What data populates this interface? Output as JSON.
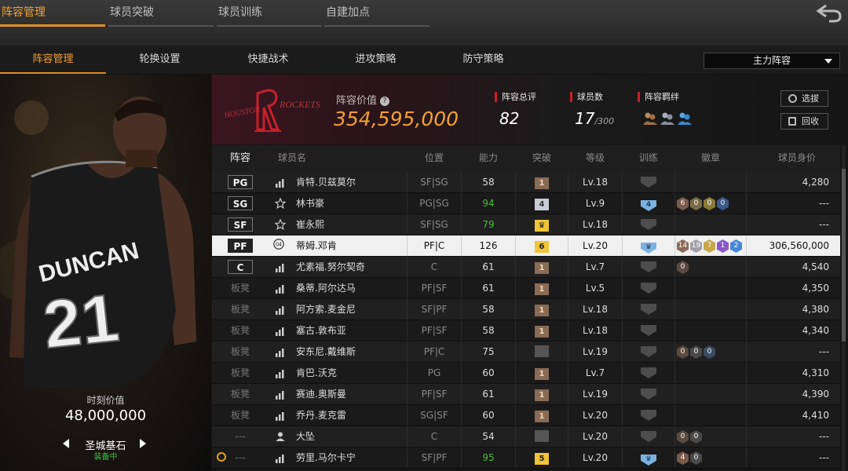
{
  "top_tabs": [
    {
      "label": "阵容管理",
      "active": true
    },
    {
      "label": "球员突破",
      "active": false
    },
    {
      "label": "球员训练",
      "active": false
    },
    {
      "label": "自建加点",
      "active": false
    }
  ],
  "sub_tabs": [
    {
      "label": "阵容管理",
      "active": true
    },
    {
      "label": "轮换设置",
      "active": false
    },
    {
      "label": "快捷战术",
      "active": false
    },
    {
      "label": "进攻策略",
      "active": false
    },
    {
      "label": "防守策略",
      "active": false
    }
  ],
  "lineup_select": {
    "value": "主力阵容"
  },
  "player_card": {
    "jersey_name": "DUNCAN",
    "jersey_number": "21",
    "moment_label": "时刻价值",
    "moment_value": "48,000,000",
    "card_name": "圣城基石",
    "equipped": "装备中"
  },
  "team": {
    "logo_text_left": "HOUSTON",
    "logo_text_right": "ROCKETS",
    "value_label": "阵容价值",
    "value": "354,595,000",
    "rating_label": "阵容总评",
    "rating": "82",
    "count_label": "球员数",
    "count": "17",
    "count_max": "/300",
    "bond_label": "阵容羁绊",
    "select_btn": "选拔",
    "recycle_btn": "回收"
  },
  "colors": {
    "accent": "#f2a033",
    "green": "#4dba3b",
    "rocket_red": "#c8202a"
  },
  "table": {
    "headers": {
      "lineup": "阵容",
      "name": "球员名",
      "position": "位置",
      "ability": "能力",
      "breakthrough": "突破",
      "level": "等级",
      "training": "训练",
      "badge": "徽章",
      "worth": "球员身价"
    },
    "rows": [
      {
        "slot": "PG",
        "badge_slot": true,
        "type": "bars",
        "name": "肯特.贝兹莫尔",
        "pos": "SF|SG",
        "ability": "58",
        "green": false,
        "brk": "1",
        "brk_color": "brown",
        "level": "Lv.18",
        "train": "",
        "badges": [],
        "worth": "4,280"
      },
      {
        "slot": "SG",
        "badge_slot": true,
        "type": "star",
        "name": "林书豪",
        "pos": "PG|SG",
        "ability": "94",
        "green": true,
        "brk": "4",
        "brk_color": "silver",
        "level": "Lv.9",
        "train": "4",
        "badges": [
          {
            "t": "6",
            "c": "#7a5a48"
          },
          {
            "t": "0",
            "c": "#7a6a48"
          },
          {
            "t": "0",
            "c": "#8a7a3a"
          },
          {
            "t": "0",
            "c": "#3a5a8a"
          }
        ],
        "worth": "---"
      },
      {
        "slot": "SF",
        "badge_slot": true,
        "type": "star",
        "name": "崔永熙",
        "pos": "SF|SG",
        "ability": "79",
        "green": true,
        "brk": "♛",
        "brk_color": "gold",
        "level": "Lv.18",
        "train": "",
        "badges": [],
        "worth": "---"
      },
      {
        "slot": "PF",
        "badge_slot": true,
        "type": "num",
        "type_text": "04",
        "name": "蒂姆.邓肯",
        "pos": "PF|C",
        "ability": "126",
        "green": false,
        "brk": "6",
        "brk_color": "gold",
        "level": "Lv.20",
        "train": "♛",
        "badges": [
          {
            "t": "14",
            "c": "#8a6a58"
          },
          {
            "t": "19",
            "c": "#a0a0a8"
          },
          {
            "t": "7",
            "c": "#c8a848"
          },
          {
            "t": "1",
            "c": "#8a58c8"
          },
          {
            "t": "2",
            "c": "#4888d8"
          }
        ],
        "worth": "306,560,000",
        "selected": true
      },
      {
        "slot": "C",
        "badge_slot": true,
        "type": "bars",
        "name": "尤素福.努尔契奇",
        "pos": "C",
        "ability": "61",
        "green": false,
        "brk": "1",
        "brk_color": "brown",
        "level": "Lv.7",
        "train": "",
        "badges": [
          {
            "t": "0",
            "c": "#5a4a40"
          }
        ],
        "worth": "4,540"
      },
      {
        "slot": "板凳",
        "badge_slot": false,
        "type": "bars",
        "name": "桑蒂.阿尔达马",
        "pos": "PF|SF",
        "ability": "61",
        "green": false,
        "brk": "1",
        "brk_color": "brown",
        "level": "Lv.5",
        "train": "",
        "badges": [],
        "worth": "4,350"
      },
      {
        "slot": "板凳",
        "badge_slot": false,
        "type": "bars",
        "name": "阿方索.麦金尼",
        "pos": "SF|PF",
        "ability": "58",
        "green": false,
        "brk": "1",
        "brk_color": "brown",
        "level": "Lv.18",
        "train": "",
        "badges": [],
        "worth": "4,380"
      },
      {
        "slot": "板凳",
        "badge_slot": false,
        "type": "bars",
        "name": "塞古.敦布亚",
        "pos": "PF|SF",
        "ability": "58",
        "green": false,
        "brk": "1",
        "brk_color": "brown",
        "level": "Lv.18",
        "train": "",
        "badges": [],
        "worth": "4,340"
      },
      {
        "slot": "板凳",
        "badge_slot": false,
        "type": "bars",
        "name": "安东尼.戴维斯",
        "pos": "PF|C",
        "ability": "75",
        "green": false,
        "brk": "",
        "brk_color": "gray",
        "level": "Lv.19",
        "train": "",
        "badges": [
          {
            "t": "0",
            "c": "#5a4a40"
          },
          {
            "t": "0",
            "c": "#4a4a4a"
          },
          {
            "t": "0",
            "c": "#3a4a60"
          }
        ],
        "worth": "---"
      },
      {
        "slot": "板凳",
        "badge_slot": false,
        "type": "bars",
        "name": "肯巴.沃克",
        "pos": "PG",
        "ability": "60",
        "green": false,
        "brk": "1",
        "brk_color": "brown",
        "level": "Lv.7",
        "train": "",
        "badges": [],
        "worth": "4,310"
      },
      {
        "slot": "板凳",
        "badge_slot": false,
        "type": "bars",
        "name": "赛迪.奥斯曼",
        "pos": "PF|SF",
        "ability": "61",
        "green": false,
        "brk": "1",
        "brk_color": "brown",
        "level": "Lv.19",
        "train": "",
        "badges": [],
        "worth": "4,390"
      },
      {
        "slot": "板凳",
        "badge_slot": false,
        "type": "bars",
        "name": "乔丹.麦克雷",
        "pos": "SG|SF",
        "ability": "60",
        "green": false,
        "brk": "1",
        "brk_color": "brown",
        "level": "Lv.20",
        "train": "",
        "badges": [],
        "worth": "4,410"
      },
      {
        "slot": "---",
        "badge_slot": false,
        "type": "person",
        "name": "大坠",
        "pos": "C",
        "ability": "54",
        "green": false,
        "brk": "",
        "brk_color": "gray",
        "level": "Lv.20",
        "train": "",
        "badges": [
          {
            "t": "0",
            "c": "#5a4a40"
          },
          {
            "t": "0",
            "c": "#4a4a4a"
          }
        ],
        "worth": "---"
      },
      {
        "slot": "---",
        "badge_slot": false,
        "type": "bars",
        "name": "劳里.马尔卡宁",
        "pos": "SF|PF",
        "ability": "95",
        "green": true,
        "brk": "5",
        "brk_color": "gold",
        "level": "Lv.20",
        "train": "♛",
        "badges": [
          {
            "t": "4",
            "c": "#7a5a48"
          },
          {
            "t": "0",
            "c": "#4a4a4a"
          }
        ],
        "worth": "---",
        "alarm": true
      }
    ]
  }
}
